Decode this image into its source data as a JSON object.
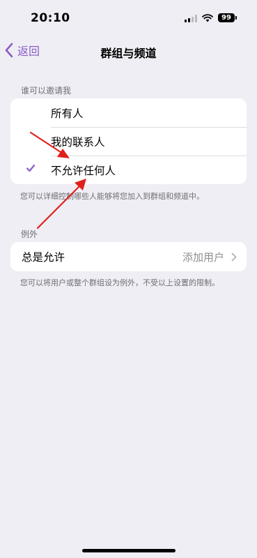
{
  "status_bar": {
    "time": "20:10",
    "battery": "99"
  },
  "nav": {
    "back_label": "返回",
    "title": "群组与频道"
  },
  "who_can_invite": {
    "header": "谁可以邀请我",
    "options": [
      {
        "label": "所有人",
        "selected": false
      },
      {
        "label": "我的联系人",
        "selected": false
      },
      {
        "label": "不允许任何人",
        "selected": true
      }
    ],
    "footer": "您可以详细控制哪些人能够将您加入到群组和频道中。"
  },
  "exceptions": {
    "header": "例外",
    "always_allow_label": "总是允许",
    "add_users_label": "添加用户",
    "footer": "您可以将用户或整个群组设为例外，不受以上设置的限制。"
  },
  "colors": {
    "accent": "#8a5cc7",
    "annotation_arrow": "#e0201b",
    "background": "#efeef4"
  }
}
